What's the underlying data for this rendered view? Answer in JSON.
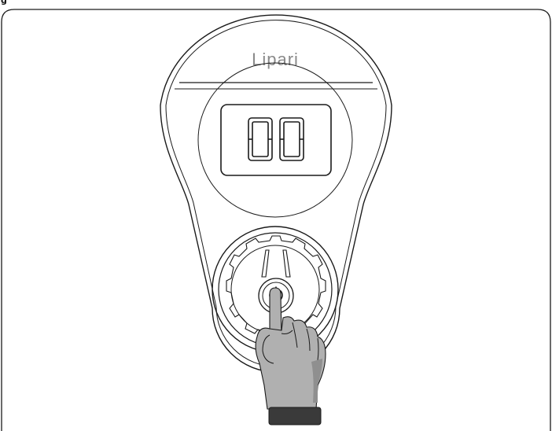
{
  "figure": {
    "label": "g"
  },
  "device": {
    "brand": "Lipari",
    "display_value": "00",
    "button_icon": "power-icon"
  },
  "gesture": {
    "icon": "pointing-hand-icon"
  },
  "colors": {
    "line": "#1a1a1a",
    "hand_fill": "#b0b0b0",
    "hand_shade": "#8f8f8f",
    "cuff": "#3a3a3a",
    "brand_text": "#8a8a8a",
    "background": "#ffffff"
  }
}
